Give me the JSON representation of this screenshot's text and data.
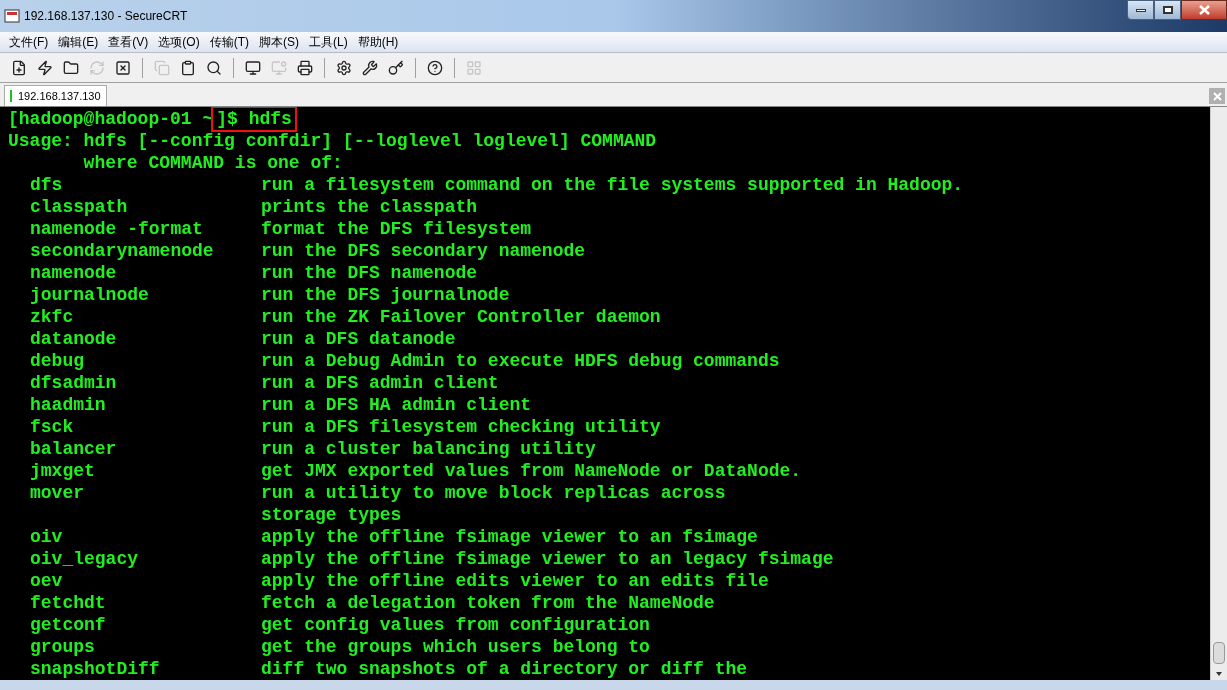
{
  "window": {
    "title": "192.168.137.130 - SecureCRT"
  },
  "menu": [
    "文件(F)",
    "编辑(E)",
    "查看(V)",
    "选项(O)",
    "传输(T)",
    "脚本(S)",
    "工具(L)",
    "帮助(H)"
  ],
  "toolbar": [
    [
      {
        "disabled": false
      },
      {
        "disabled": false
      },
      {
        "disabled": false
      },
      {
        "disabled": true
      },
      {
        "disabled": false
      }
    ],
    [
      {
        "disabled": true
      },
      {
        "disabled": false
      },
      {
        "disabled": false
      }
    ],
    [
      {
        "disabled": false
      },
      {
        "disabled": true
      },
      {
        "disabled": false
      }
    ],
    [
      {
        "disabled": false
      },
      {
        "disabled": false
      },
      {
        "disabled": false
      }
    ],
    [
      {
        "disabled": false
      }
    ],
    [
      {
        "disabled": true
      }
    ]
  ],
  "tabs": [
    {
      "label": "192.168.137.130",
      "selected": true,
      "connected": true
    }
  ],
  "terminal": {
    "prompt": "[hadoop@hadoop-01 ~",
    "highlighted_command": "]$ hdfs",
    "lines": [
      {
        "text": "Usage: hdfs [--config confdir] [--loglevel loglevel] COMMAND"
      },
      {
        "text": "       where COMMAND is one of:"
      },
      {
        "command": "dfs",
        "description": "run a filesystem command on the file systems supported in Hadoop."
      },
      {
        "command": "classpath",
        "description": "prints the classpath"
      },
      {
        "command": "namenode -format",
        "description": "format the DFS filesystem"
      },
      {
        "command": "secondarynamenode",
        "description": "run the DFS secondary namenode"
      },
      {
        "command": "namenode",
        "description": "run the DFS namenode"
      },
      {
        "command": "journalnode",
        "description": "run the DFS journalnode"
      },
      {
        "command": "zkfc",
        "description": "run the ZK Failover Controller daemon"
      },
      {
        "command": "datanode",
        "description": "run a DFS datanode"
      },
      {
        "command": "debug",
        "description": "run a Debug Admin to execute HDFS debug commands"
      },
      {
        "command": "dfsadmin",
        "description": "run a DFS admin client"
      },
      {
        "command": "haadmin",
        "description": "run a DFS HA admin client"
      },
      {
        "command": "fsck",
        "description": "run a DFS filesystem checking utility"
      },
      {
        "command": "balancer",
        "description": "run a cluster balancing utility"
      },
      {
        "command": "jmxget",
        "description": "get JMX exported values from NameNode or DataNode."
      },
      {
        "command": "mover",
        "description": "run a utility to move block replicas across"
      },
      {
        "description": "storage types"
      },
      {
        "command": "oiv",
        "description": "apply the offline fsimage viewer to an fsimage"
      },
      {
        "command": "oiv_legacy",
        "description": "apply the offline fsimage viewer to an legacy fsimage"
      },
      {
        "command": "oev",
        "description": "apply the offline edits viewer to an edits file"
      },
      {
        "command": "fetchdt",
        "description": "fetch a delegation token from the NameNode"
      },
      {
        "command": "getconf",
        "description": "get config values from configuration"
      },
      {
        "command": "groups",
        "description": "get the groups which users belong to"
      },
      {
        "command": "snapshotDiff",
        "description": "diff two snapshots of a directory or diff the"
      }
    ]
  }
}
